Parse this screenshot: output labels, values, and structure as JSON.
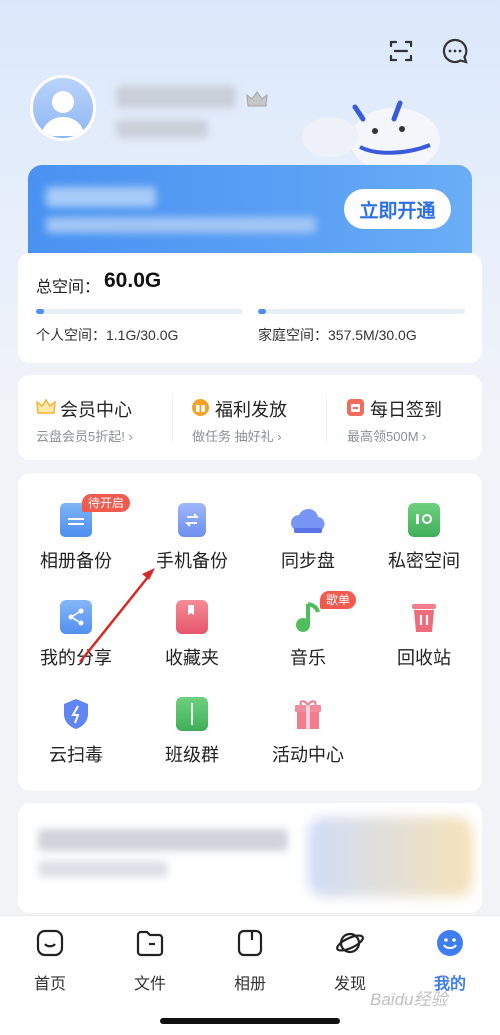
{
  "header": {
    "scan_icon": "scan-icon",
    "message_icon": "message-icon"
  },
  "vip": {
    "open_label": "立即开通"
  },
  "storage": {
    "total_label": "总空间：",
    "total_value": "60.0G",
    "personal_label": "个人空间：",
    "personal_value": "1.1G/30.0G",
    "personal_fraction": 0.037,
    "family_label": "家庭空间：",
    "family_value": "357.5M/30.0G",
    "family_fraction": 0.012,
    "accent": "#4c8df0"
  },
  "quick": [
    {
      "title": "会员中心",
      "sub": "云盘会员5折起!",
      "icon": "crown-icon",
      "color": "#f3b43c"
    },
    {
      "title": "福利发放",
      "sub": "做任务 抽好礼",
      "icon": "gift-icon",
      "color": "#f4a227"
    },
    {
      "title": "每日签到",
      "sub": "最高领500M",
      "icon": "calendar-icon",
      "color": "#f26b5b"
    }
  ],
  "grid": [
    {
      "label": "相册备份",
      "icon": "folder-photo-icon",
      "color": "#5b9af2",
      "badge": "待开启"
    },
    {
      "label": "手机备份",
      "icon": "phone-backup-icon",
      "color": "#6c8ff0",
      "badge": ""
    },
    {
      "label": "同步盘",
      "icon": "cloud-icon",
      "color": "#6e8cf3",
      "badge": ""
    },
    {
      "label": "私密空间",
      "icon": "safe-icon",
      "color": "#52b86a",
      "badge": ""
    },
    {
      "label": "我的分享",
      "icon": "share-icon",
      "color": "#5b9af2",
      "badge": ""
    },
    {
      "label": "收藏夹",
      "icon": "bookmark-icon",
      "color": "#ef6a78",
      "badge": ""
    },
    {
      "label": "音乐",
      "icon": "music-icon",
      "color": "#4fbf5e",
      "badge": "歌单"
    },
    {
      "label": "回收站",
      "icon": "trash-icon",
      "color": "#ee6b7c",
      "badge": ""
    },
    {
      "label": "云扫毒",
      "icon": "shield-icon",
      "color": "#5f86f2",
      "badge": ""
    },
    {
      "label": "班级群",
      "icon": "book-icon",
      "color": "#4fbf6a",
      "badge": ""
    },
    {
      "label": "活动中心",
      "icon": "gift-box-icon",
      "color": "#f07c8c",
      "badge": ""
    }
  ],
  "tabs": [
    {
      "label": "首页",
      "icon": "home-icon",
      "active": false
    },
    {
      "label": "文件",
      "icon": "folder-icon",
      "active": false
    },
    {
      "label": "相册",
      "icon": "album-icon",
      "active": false
    },
    {
      "label": "发现",
      "icon": "planet-icon",
      "active": false
    },
    {
      "label": "我的",
      "icon": "smile-icon",
      "active": true
    }
  ],
  "active_color": "#3f7ef0",
  "watermark": "Baidu经验"
}
